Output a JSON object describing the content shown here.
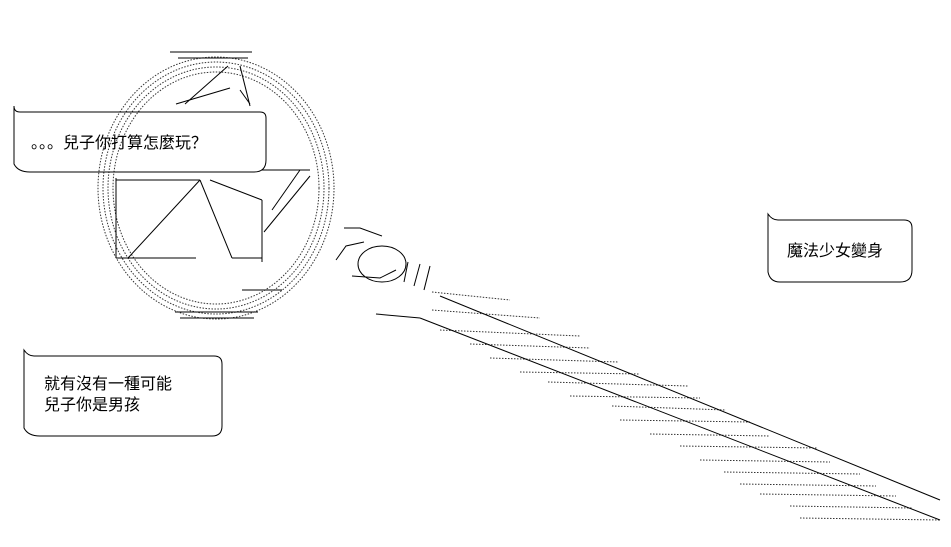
{
  "bubbles": {
    "son_question": "。。。兒子你打算怎麼玩？",
    "magic_girl": "魔法少女變身",
    "possibility_line1": "就有沒有一種可能",
    "possibility_line2": "兒子你是男孩"
  },
  "colors": {
    "background": "#ffffff",
    "ink": "#000000"
  }
}
